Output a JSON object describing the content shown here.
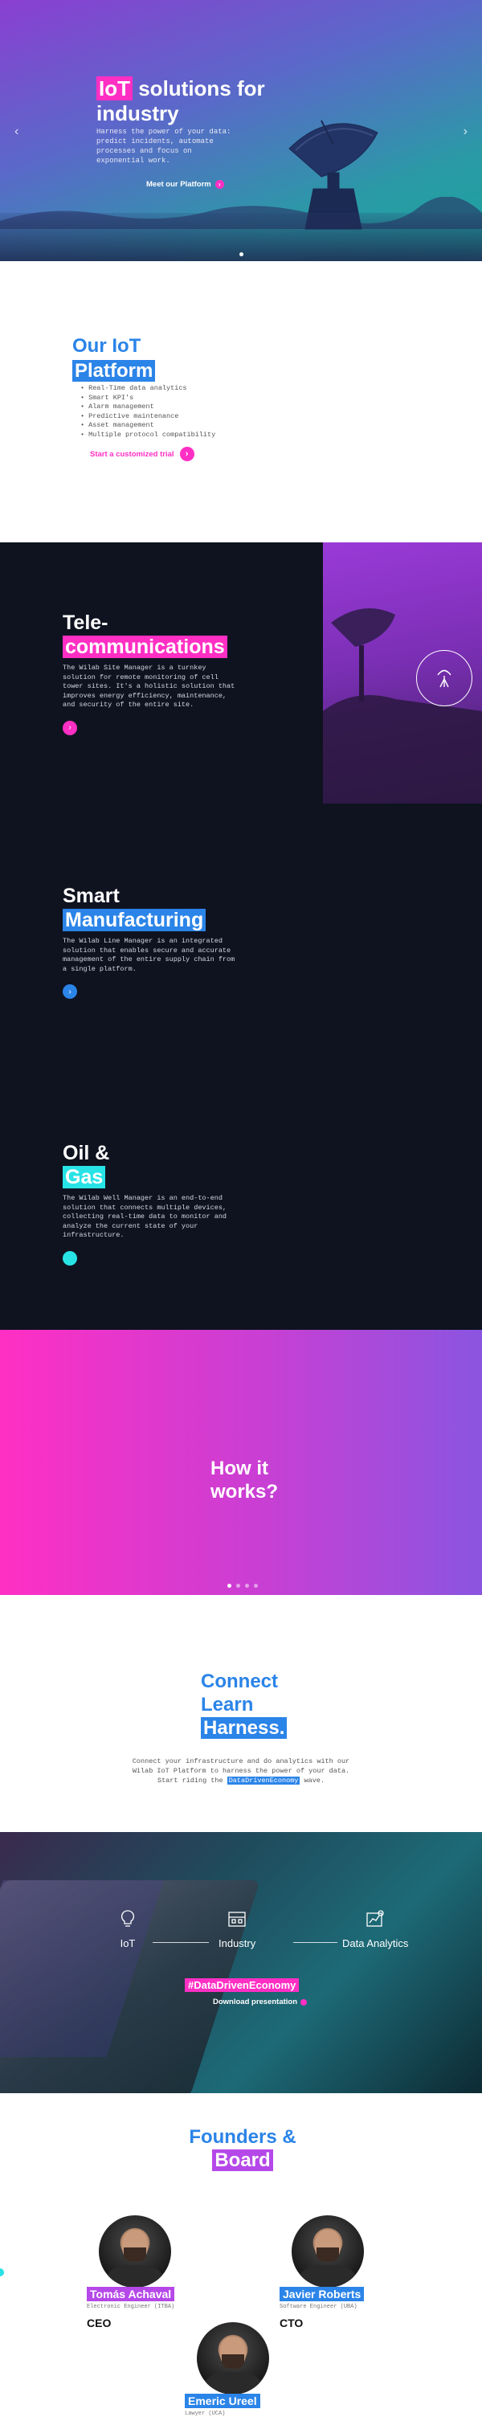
{
  "hero": {
    "title_highlight": "IoT",
    "title_rest": " solutions for industry",
    "text": "Harness the power of your data: predict incidents, automate processes and focus on exponential work.",
    "cta": "Meet our Platform",
    "prev": "‹",
    "next": "›"
  },
  "platform": {
    "title_line1": "Our IoT",
    "title_line2": "Platform",
    "features": [
      "Real-Time data analytics",
      "Smart KPI's",
      "Alarm management",
      "Predictive maintenance",
      "Asset management",
      "Multiple protocol compatibility"
    ],
    "cta": "Start a customized trial"
  },
  "industries": [
    {
      "title_line1": "Tele-",
      "title_line2": "communications",
      "text": "The Wilab Site Manager is a turnkey solution for remote monitoring of cell tower sites. It's a holistic solution that improves energy efficiency, maintenance, and security of the entire site.",
      "color": "#ff2fc4"
    },
    {
      "title_line1": "Smart",
      "title_line2": "Manufacturing",
      "text": "The Wilab Line Manager is an integrated solution that enables secure and accurate management of the entire supply chain from a single platform.",
      "color": "#2b84e8"
    },
    {
      "title_line1": "Oil &",
      "title_line2": "Gas",
      "text": "The Wilab Well Manager is an end-to-end solution that connects multiple devices, collecting real-time data to monitor and analyze the current state of your infrastructure.",
      "color": "#27e3e6"
    }
  ],
  "how": {
    "title": "How it works?"
  },
  "connect": {
    "line1": "Connect",
    "line2": "Learn",
    "line3": "Harness.",
    "text_before": "Connect your infrastructure and do analytics with our Wilab IoT Platform to harness the power of your data. Start riding the ",
    "text_tag": "DataDrivenEconomy",
    "text_after": " wave."
  },
  "data_band": {
    "nodes": [
      "IoT",
      "Industry",
      "Data Analytics"
    ],
    "hashtag": "#DataDrivenEconomy",
    "download": "Download presentation"
  },
  "founders": {
    "title_line1": "Founders &",
    "title_line2": "Board",
    "people": [
      {
        "name": "Tomás Achaval",
        "sub": "Electronic Engineer (ITBA)",
        "role": "CEO",
        "color": "#b548e8"
      },
      {
        "name": "Javier Roberts",
        "sub": "Software Engineer (UBA)",
        "role": "CTO",
        "color": "#2b84e8"
      },
      {
        "name": "Emeric Ureel",
        "sub": "Lawyer (UCA)",
        "role": "",
        "color": "#2b84e8"
      }
    ]
  }
}
